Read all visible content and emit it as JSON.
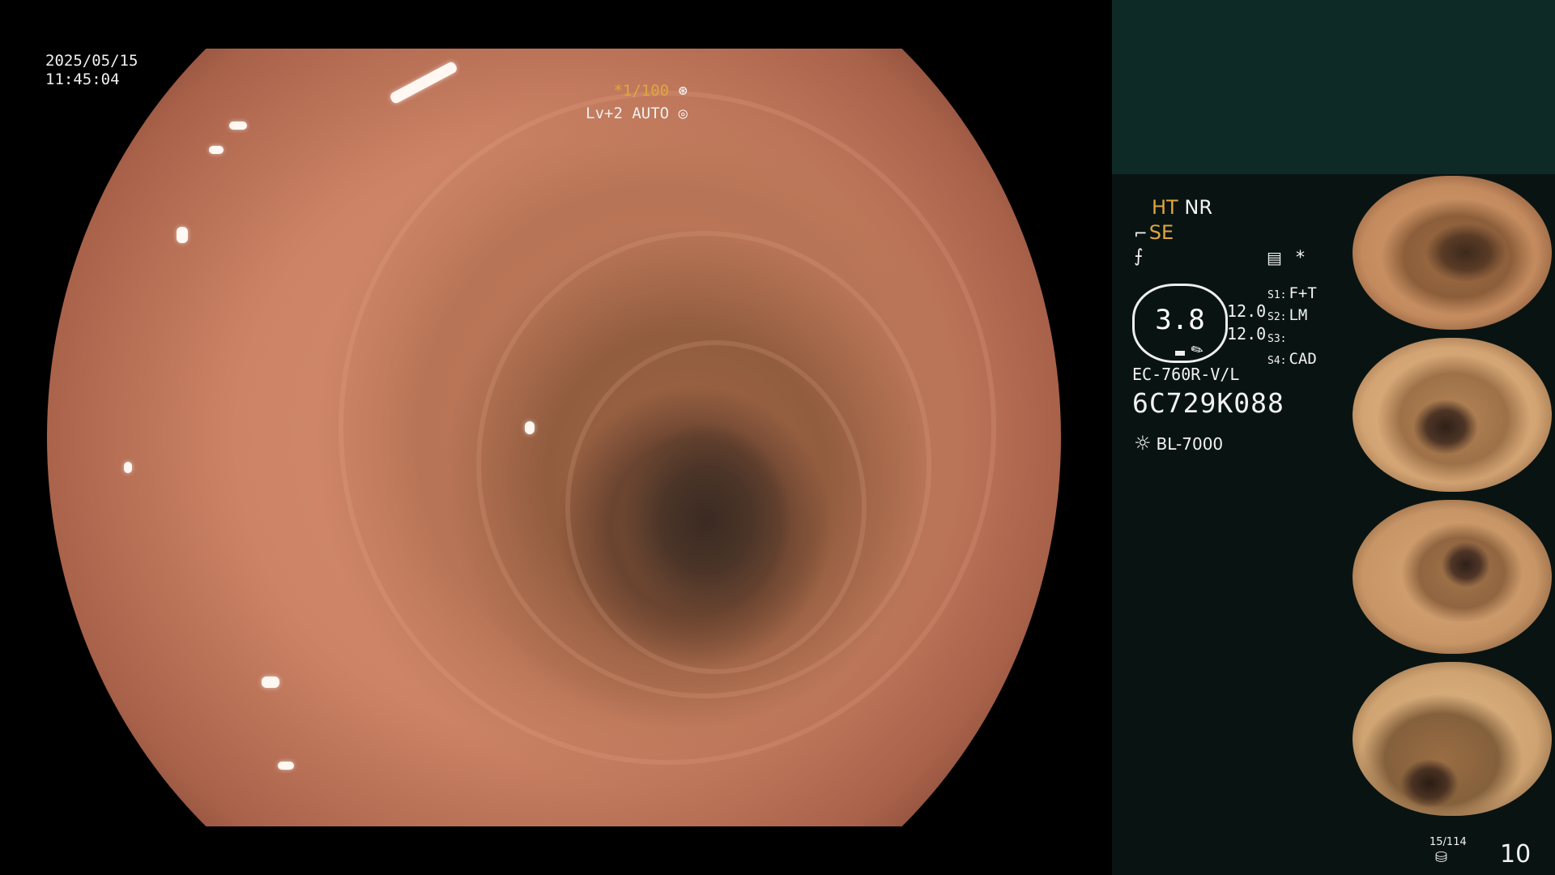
{
  "main_view": {
    "date": "2025/05/15",
    "time": "11:45:04",
    "shutter": "*1/100",
    "level": "Lv+2 AUTO"
  },
  "status": {
    "ht": "HT",
    "nr": "NR",
    "se": "SE",
    "star": "*"
  },
  "gauge": {
    "value": "3.8"
  },
  "settings": {
    "val1": "12.0",
    "val2": "12.0",
    "s1_key": "S1:",
    "s1_val": "F+T",
    "s2_key": "S2:",
    "s2_val": "LM",
    "s3_key": "S3:",
    "s3_val": "",
    "s4_key": "S4:",
    "s4_val": "CAD"
  },
  "scope": {
    "model": "EC-760R-V/L",
    "serial": "6C729K088",
    "light_source": "BL-7000"
  },
  "thumbnails": [
    {
      "name": "thumbnail-1"
    },
    {
      "name": "thumbnail-2"
    },
    {
      "name": "thumbnail-3"
    },
    {
      "name": "thumbnail-4"
    }
  ],
  "footer": {
    "image_count": "15/114",
    "page_number": "10"
  },
  "colors": {
    "panel_bg": "#091412",
    "panel_top": "#0e2a26",
    "accent_orange": "#e0a640"
  },
  "icons": {
    "shutter": "aperture-icon",
    "auto": "iris-icon",
    "light": "lamp-icon",
    "storage": "database-icon",
    "structure": "structure-enhance-icon"
  }
}
